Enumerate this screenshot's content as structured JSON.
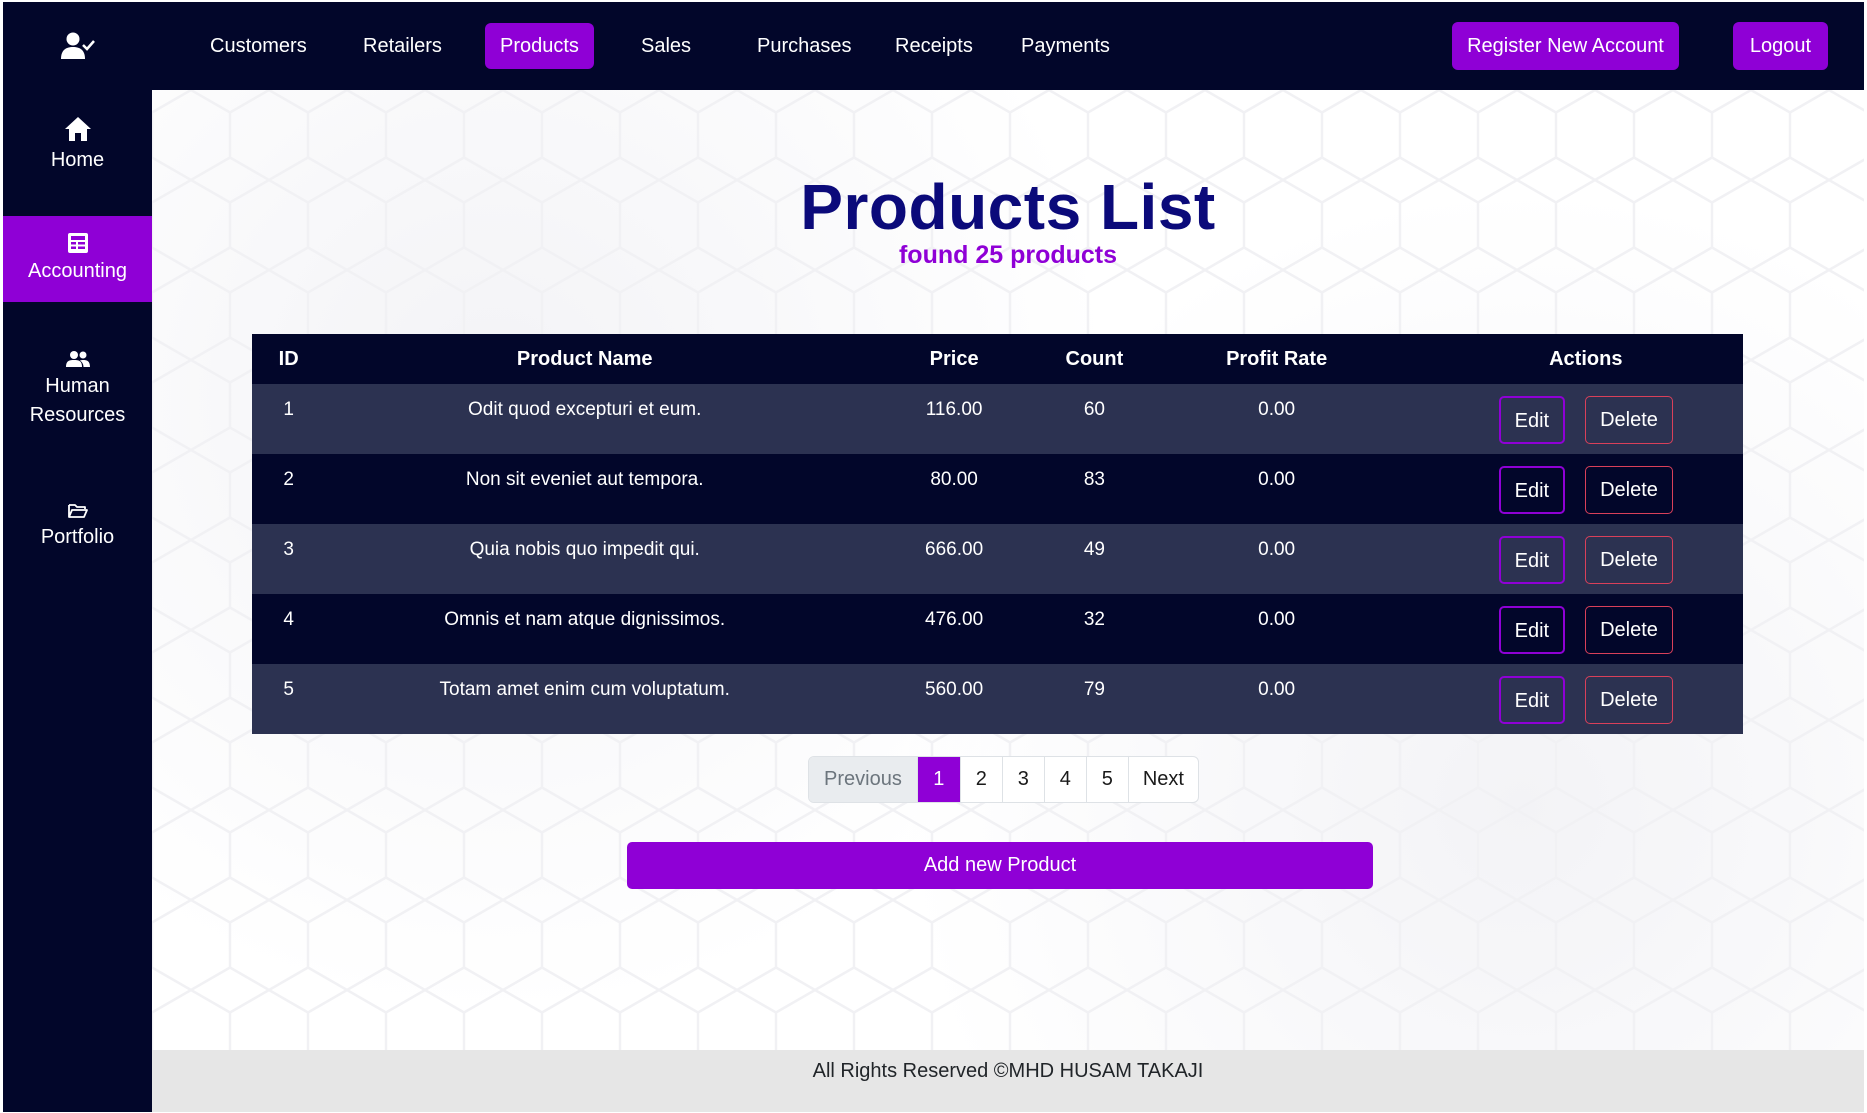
{
  "sidebar": {
    "items": [
      {
        "label": "Home",
        "icon": "home-icon"
      },
      {
        "label": "Accounting",
        "icon": "accounting-icon"
      },
      {
        "label_line1": "Human",
        "label_line2": "Resources",
        "icon": "users-icon"
      },
      {
        "label": "Portfolio",
        "icon": "folder-icon"
      }
    ],
    "active": "Accounting"
  },
  "nav": {
    "links": [
      "Customers",
      "Retailers",
      "Products",
      "Sales",
      "Purchases",
      "Receipts",
      "Payments"
    ],
    "active": "Products",
    "register_label": "Register New Account",
    "logout_label": "Logout"
  },
  "page": {
    "title": "Products List",
    "subtitle": "found 25 products"
  },
  "table": {
    "headers": [
      "ID",
      "Product Name",
      "Price",
      "Count",
      "Profit Rate",
      "Actions"
    ],
    "rows": [
      {
        "id": "1",
        "name": "Odit quod excepturi et eum.",
        "price": "116.00",
        "count": "60",
        "profit": "0.00"
      },
      {
        "id": "2",
        "name": "Non sit eveniet aut tempora.",
        "price": "80.00",
        "count": "83",
        "profit": "0.00"
      },
      {
        "id": "3",
        "name": "Quia nobis quo impedit qui.",
        "price": "666.00",
        "count": "49",
        "profit": "0.00"
      },
      {
        "id": "4",
        "name": "Omnis et nam atque dignissimos.",
        "price": "476.00",
        "count": "32",
        "profit": "0.00"
      },
      {
        "id": "5",
        "name": "Totam amet enim cum voluptatum.",
        "price": "560.00",
        "count": "79",
        "profit": "0.00"
      }
    ],
    "edit_label": "Edit",
    "delete_label": "Delete"
  },
  "pagination": {
    "previous": "Previous",
    "pages": [
      "1",
      "2",
      "3",
      "4",
      "5"
    ],
    "current": "1",
    "next": "Next"
  },
  "add_button": "Add new Product",
  "footer": "All Rights Reserved ©MHD HUSAM TAKAJI",
  "colors": {
    "accent": "#8f00d6",
    "dark": "#02062a",
    "row_alt": "#2c3251",
    "title": "#0b0a7a",
    "danger": "#d9405a"
  }
}
